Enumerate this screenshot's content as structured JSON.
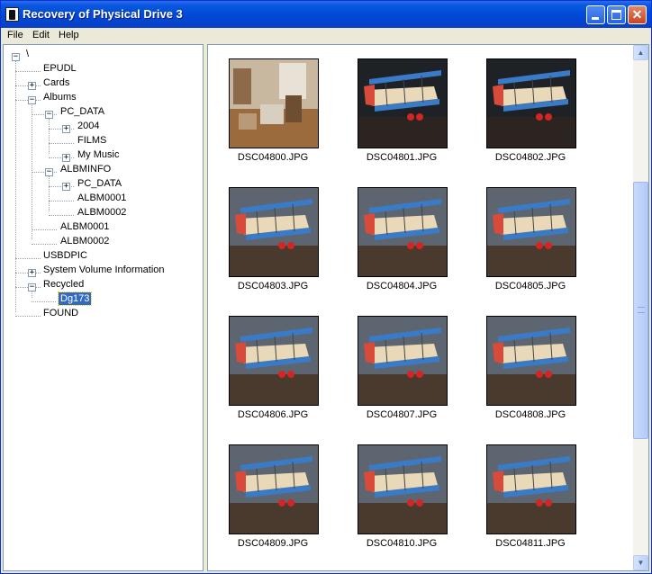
{
  "window": {
    "title": "Recovery of Physical Drive 3"
  },
  "menu": {
    "file": "File",
    "edit": "Edit",
    "help": "Help"
  },
  "tree": {
    "root": "\\",
    "epudl": "EPUDL",
    "cards": "Cards",
    "albums": "Albums",
    "pc_data": "PC_DATA",
    "y2004": "2004",
    "films": "FILMS",
    "my_music": "My Music",
    "albminfo": "ALBMINFO",
    "albminfo_pc_data": "PC_DATA",
    "albminfo_albm0001": "ALBM0001",
    "albminfo_albm0002": "ALBM0002",
    "albm0001": "ALBM0001",
    "albm0002": "ALBM0002",
    "usbdpic": "USBDPIC",
    "system_volume_information": "System Volume Information",
    "recycled": "Recycled",
    "dg173": "Dg173",
    "found": "FOUND"
  },
  "thumbnails": [
    {
      "name": "DSC04800.JPG",
      "kind": "room"
    },
    {
      "name": "DSC04801.JPG",
      "kind": "plane-dark"
    },
    {
      "name": "DSC04802.JPG",
      "kind": "plane-dark"
    },
    {
      "name": "DSC04803.JPG",
      "kind": "plane"
    },
    {
      "name": "DSC04804.JPG",
      "kind": "plane"
    },
    {
      "name": "DSC04805.JPG",
      "kind": "plane"
    },
    {
      "name": "DSC04806.JPG",
      "kind": "plane"
    },
    {
      "name": "DSC04807.JPG",
      "kind": "plane"
    },
    {
      "name": "DSC04808.JPG",
      "kind": "plane"
    },
    {
      "name": "DSC04809.JPG",
      "kind": "plane"
    },
    {
      "name": "DSC04810.JPG",
      "kind": "plane"
    },
    {
      "name": "DSC04811.JPG",
      "kind": "plane"
    }
  ],
  "icons": {
    "app": "app-icon",
    "minimize": "minimize-icon",
    "maximize": "maximize-icon",
    "close": "close-icon",
    "expand": "plus-box-icon",
    "collapse": "minus-box-icon",
    "scroll_up": "arrow-up-icon",
    "scroll_down": "arrow-down-icon"
  },
  "colors": {
    "titlebar": "#0049D6",
    "selection": "#316AC5",
    "frame": "#ECE9D8"
  }
}
